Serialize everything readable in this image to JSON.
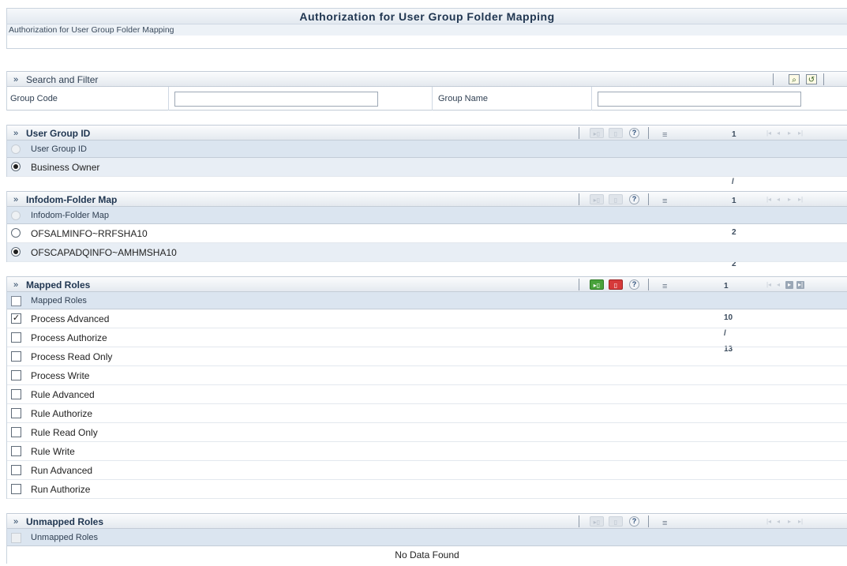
{
  "page": {
    "title": "Authorization for User Group Folder Mapping",
    "breadcrumb": "Authorization for User Group Folder Mapping"
  },
  "search_filter": {
    "title": "Search and Filter",
    "search_icon": "search-icon",
    "reset_icon": "reset-icon",
    "group_code_label": "Group Code",
    "group_code_value": "",
    "group_name_label": "Group Name",
    "group_name_value": ""
  },
  "user_group": {
    "title": "User Group ID",
    "column": "User Group ID",
    "paging": "1 - 1 / 1",
    "rows": [
      {
        "label": "Business Owner",
        "selected": true
      }
    ]
  },
  "infodom": {
    "title": "Infodom-Folder Map",
    "column": "Infodom-Folder Map",
    "paging": "1 - 2 / 2",
    "rows": [
      {
        "label": "OFSALMINFO~RRFSHA10",
        "selected": false
      },
      {
        "label": "OFSCAPADQINFO~AMHMSHA10",
        "selected": true
      }
    ]
  },
  "mapped_roles": {
    "title": "Mapped Roles",
    "column": "Mapped Roles",
    "paging": "1 - 10 / 13",
    "rows": [
      {
        "label": "Process Advanced",
        "checked": true
      },
      {
        "label": "Process Authorize",
        "checked": false
      },
      {
        "label": "Process Read Only",
        "checked": false
      },
      {
        "label": "Process Write",
        "checked": false
      },
      {
        "label": "Rule Advanced",
        "checked": false
      },
      {
        "label": "Rule Authorize",
        "checked": false
      },
      {
        "label": "Rule Read Only",
        "checked": false
      },
      {
        "label": "Rule Write",
        "checked": false
      },
      {
        "label": "Run Advanced",
        "checked": false
      },
      {
        "label": "Run Authorize",
        "checked": false
      }
    ]
  },
  "unmapped_roles": {
    "title": "Unmapped Roles",
    "column": "Unmapped Roles",
    "paging": "",
    "empty_text": "No Data Found"
  },
  "toolbar": {
    "help": "?",
    "chevron": "»",
    "menu": "≡"
  }
}
